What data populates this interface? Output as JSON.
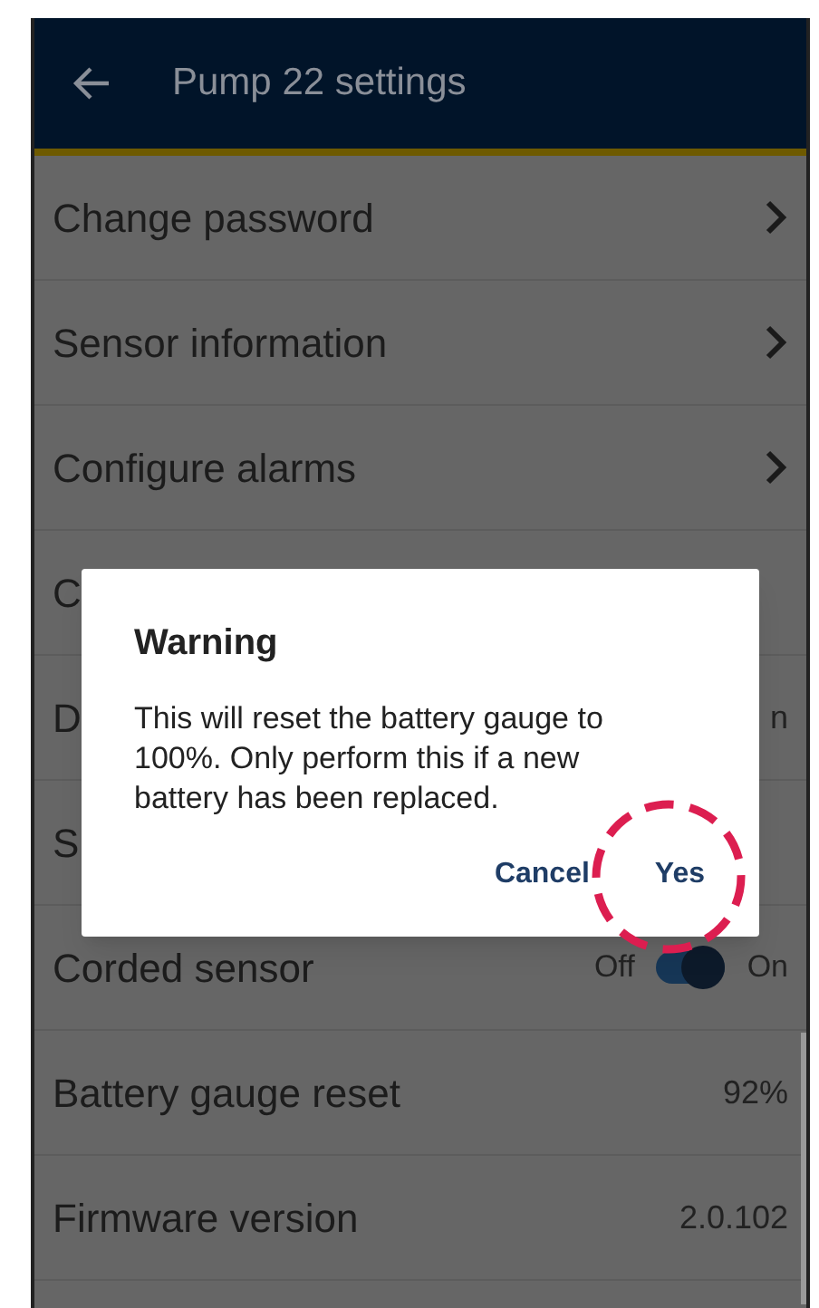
{
  "header": {
    "title": "Pump 22 settings"
  },
  "rows": [
    {
      "kind": "nav",
      "label": "Change password"
    },
    {
      "kind": "nav",
      "label": "Sensor information"
    },
    {
      "kind": "nav",
      "label": "Configure alarms"
    },
    {
      "kind": "partial",
      "label": "C"
    },
    {
      "kind": "partial",
      "label": "D",
      "value": "n"
    },
    {
      "kind": "partial",
      "label": "S"
    },
    {
      "kind": "toggle",
      "label": "Corded sensor",
      "off_label": "Off",
      "on_label": "On",
      "on": true
    },
    {
      "kind": "value",
      "label": "Battery gauge reset",
      "value": "92%"
    },
    {
      "kind": "value",
      "label": "Firmware version",
      "value": "2.0.102"
    }
  ],
  "dialog": {
    "title": "Warning",
    "message": "This will reset the battery gauge to 100%.  Only perform this if a new battery has been replaced.",
    "buttons": [
      {
        "label": "Cancel",
        "highlighted": false
      },
      {
        "label": "Yes",
        "highlighted": true
      }
    ]
  }
}
